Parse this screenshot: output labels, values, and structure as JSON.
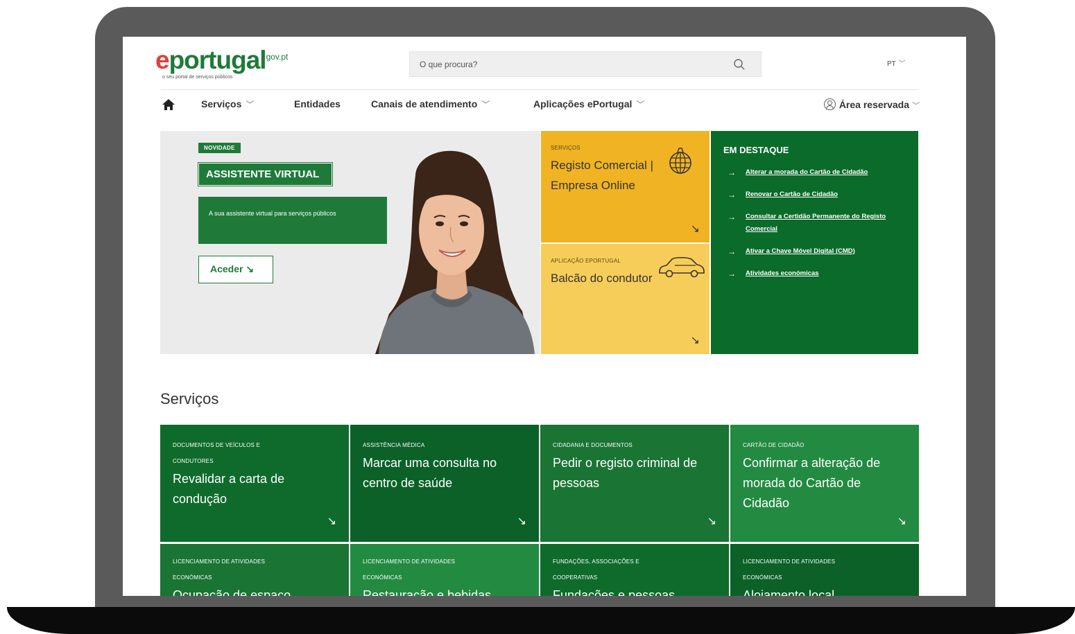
{
  "logo": {
    "e": "e",
    "name": "portugal",
    "domain": "gov.pt",
    "tagline": "o seu portal de serviços públicos"
  },
  "search": {
    "placeholder": "O que procura?"
  },
  "lang": {
    "label": "PT"
  },
  "nav": {
    "items": [
      {
        "label": "Serviços",
        "dropdown": true
      },
      {
        "label": "Entidades",
        "dropdown": false
      },
      {
        "label": "Canais de atendimento",
        "dropdown": true
      },
      {
        "label": "Aplicações ePortugal",
        "dropdown": true
      }
    ],
    "reserved": "Área reservada"
  },
  "hero": {
    "badge": "NOVIDADE",
    "title": "ASSISTENTE VIRTUAL",
    "description": "A sua assistente virtual para serviços públicos",
    "button": "Aceder ↘"
  },
  "cards": [
    {
      "category": "SERVIÇOS",
      "title": "Registo Comercial | Empresa Online",
      "arrow": "↘",
      "icon": "globe-icon"
    },
    {
      "category": "APLICAÇÃO EPORTUGAL",
      "title": "Balcão do condutor",
      "arrow": "↘",
      "icon": "car-icon"
    }
  ],
  "highlights": {
    "title": "EM DESTAQUE",
    "arrow": "→",
    "items": [
      "Alterar a morada do Cartão de Cidadão",
      "Renovar o Cartão de Cidadão",
      "Consultar a Certidão Permanente do Registo Comercial",
      "Ativar a Chave Móvel Digital (CMD)",
      "Atividades económicas"
    ]
  },
  "services": {
    "title": "Serviços",
    "arrow": "↘",
    "tiles": [
      {
        "category": "DOCUMENTOS DE VEÍCULOS E CONDUTORES",
        "title": "Revalidar a carta de condução"
      },
      {
        "category": "ASSISTÊNCIA MÉDICA",
        "title": "Marcar uma consulta no centro de saúde"
      },
      {
        "category": "CIDADANIA E DOCUMENTOS",
        "title": "Pedir o registo criminal de pessoas"
      },
      {
        "category": "CARTÃO DE CIDADÃO",
        "title": "Confirmar a alteração de morada do Cartão de Cidadão"
      },
      {
        "category": "LICENCIAMENTO DE ATIVIDADES ECONÓMICAS",
        "title": "Ocupação de espaço"
      },
      {
        "category": "LICENCIAMENTO DE ATIVIDADES ECONÓMICAS",
        "title": "Restauração e bebidas"
      },
      {
        "category": "FUNDAÇÕES, ASSOCIAÇÕES E COOPERATIVAS",
        "title": "Fundações e pessoas"
      },
      {
        "category": "LICENCIAMENTO DE ATIVIDADES ECONÓMICAS",
        "title": "Alojamento local"
      }
    ]
  },
  "colors": {
    "brand_green": "#1f7a3a",
    "dark_green": "#0b6b2a",
    "yellow": "#f0b323",
    "light_yellow": "#f7cd5a",
    "red": "#e0403a"
  }
}
